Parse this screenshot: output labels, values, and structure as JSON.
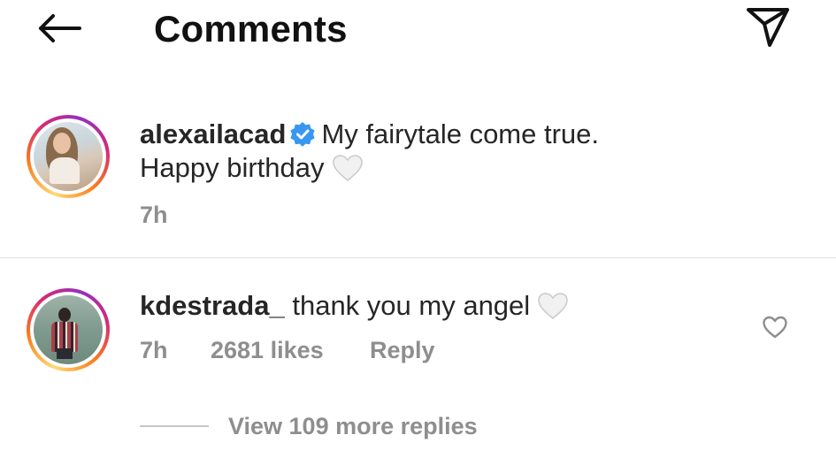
{
  "header": {
    "title": "Comments",
    "back_icon": "arrow-left-icon",
    "send_icon": "paper-plane-icon"
  },
  "caption": {
    "username": "alexailacad",
    "verified": true,
    "text_line1": "My fairytale come true.",
    "text_line2": "Happy birthday",
    "emoji": "white-heart",
    "time": "7h"
  },
  "comment": {
    "username": "kdestrada_",
    "text": "thank you my angel",
    "emoji": "white-heart",
    "time": "7h",
    "likes": "2681 likes",
    "reply_label": "Reply"
  },
  "replies": {
    "label": "View 109 more replies"
  },
  "colors": {
    "text": "#262626",
    "secondary": "#8e8e8e",
    "verified": "#3897f0",
    "divider": "#e3e3e3"
  }
}
